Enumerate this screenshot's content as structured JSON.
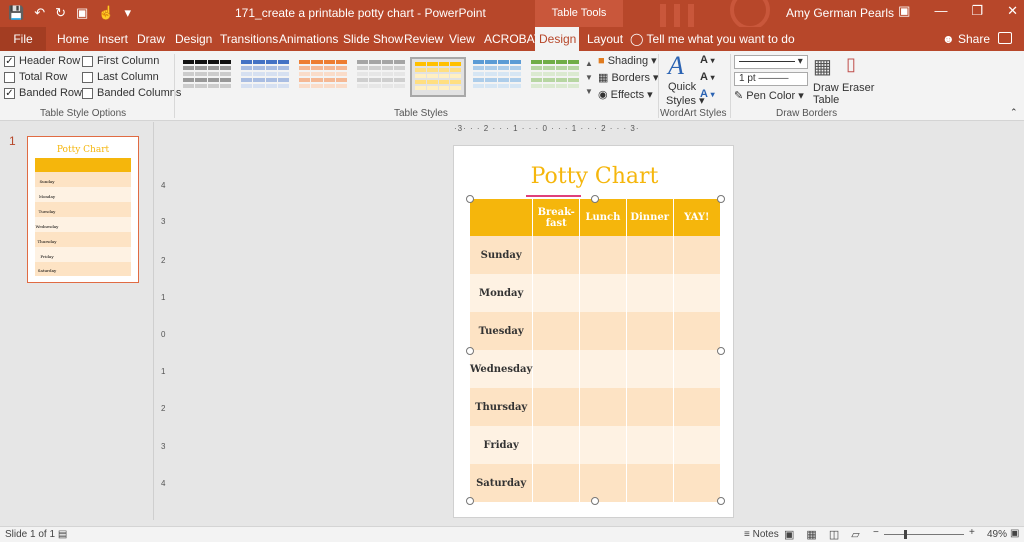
{
  "titlebar": {
    "doc_title": "171_create a printable potty chart  -  PowerPoint",
    "context_tab": "Table Tools",
    "user": "Amy German Pearls"
  },
  "tabs": [
    {
      "label": "File"
    },
    {
      "label": "Home"
    },
    {
      "label": "Insert"
    },
    {
      "label": "Draw"
    },
    {
      "label": "Design"
    },
    {
      "label": "Transitions"
    },
    {
      "label": "Animations"
    },
    {
      "label": "Slide Show"
    },
    {
      "label": "Review"
    },
    {
      "label": "View"
    },
    {
      "label": "ACROBAT"
    },
    {
      "label": "Design"
    },
    {
      "label": "Layout"
    }
  ],
  "tell_me": "Tell me what you want to do",
  "share": "Share",
  "ribbon": {
    "table_style_options": {
      "label": "Table Style Options",
      "header_row": "Header Row",
      "first_column": "First Column",
      "total_row": "Total Row",
      "last_column": "Last Column",
      "banded_rows": "Banded Rows",
      "banded_columns": "Banded Columns"
    },
    "table_styles": {
      "label": "Table Styles"
    },
    "shading": "Shading",
    "borders": "Borders",
    "effects": "Effects",
    "wordart": {
      "label": "WordArt Styles",
      "quick": "Quick",
      "styles": "Styles"
    },
    "draw_borders": {
      "label": "Draw Borders",
      "pen_weight": "1 pt",
      "pen_color": "Pen Color",
      "draw": "Draw",
      "table": "Table",
      "eraser": "Eraser"
    }
  },
  "thumbnail": {
    "number": "1"
  },
  "ruler_h": "·3· · · 2 · · · 1 · · · 0 · · · 1 · · · 2 · · · 3·",
  "slide": {
    "title": "Potty Chart",
    "table": {
      "headers": [
        "",
        "Break-\nfast",
        "Lunch",
        "Dinner",
        "YAY!"
      ],
      "days": [
        "Sunday",
        "Monday",
        "Tuesday",
        "Wednesday",
        "Thursday",
        "Friday",
        "Saturday"
      ]
    }
  },
  "status": {
    "slide_count": "Slide 1 of 1",
    "notes": "Notes",
    "zoom": "49%"
  },
  "colors": {
    "accent": "#b7472a",
    "table_header": "#f5b60c",
    "band_odd": "#fde3c4",
    "band_even": "#fef2e3"
  }
}
